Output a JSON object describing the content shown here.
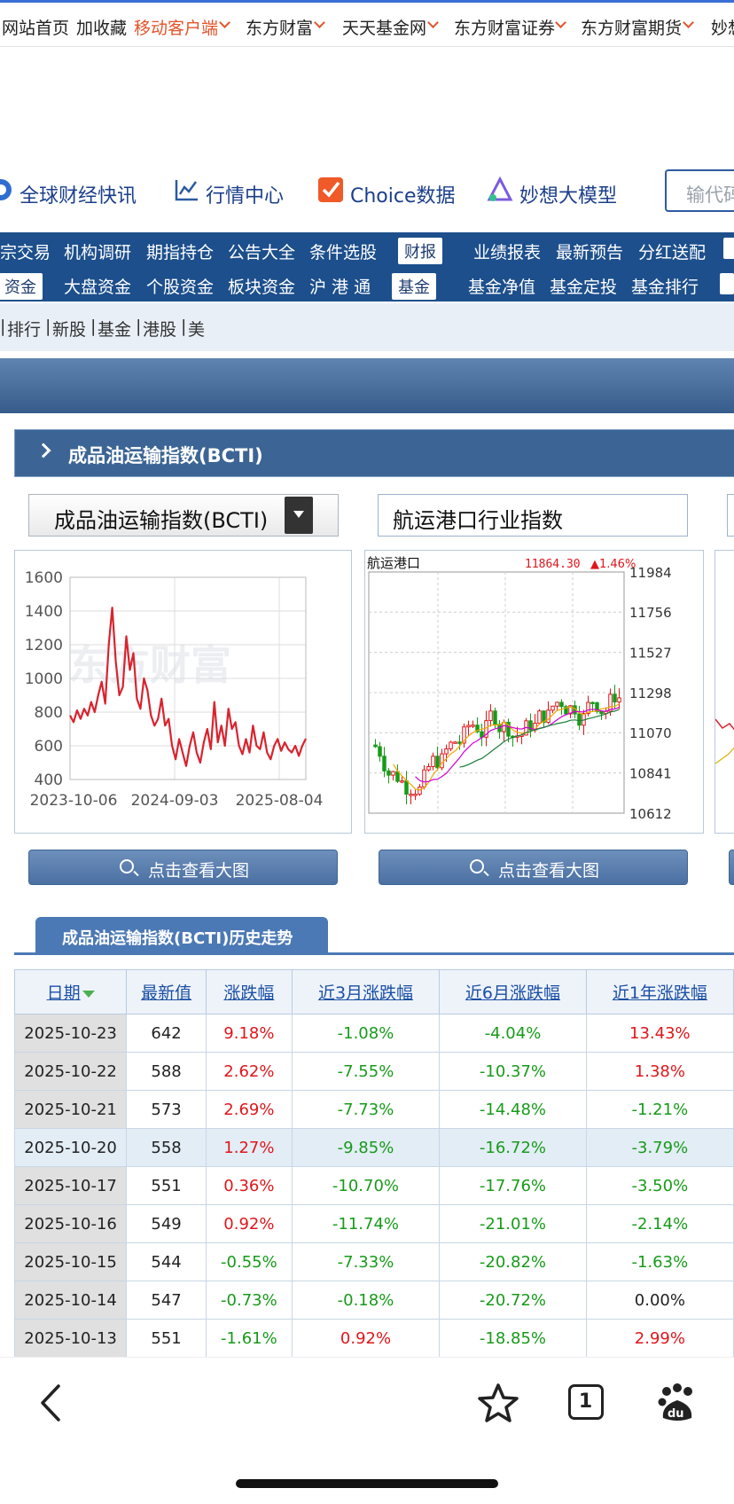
{
  "top_nav": {
    "items": [
      "网站首页",
      "加收藏",
      "移动客户端",
      "东方财富",
      "天天基金网",
      "东方财富证券",
      "东方财富期货",
      "妙想"
    ]
  },
  "secondary_nav": {
    "items": [
      "全球财经快讯",
      "行情中心",
      "Choice数据",
      "妙想大模型"
    ],
    "search_placeholder": "输代码"
  },
  "blue_menu": {
    "row1": [
      "宗交易",
      "机构调研",
      "期指持仓",
      "公告大全",
      "条件选股",
      "财报",
      "业绩报表",
      "最新预告",
      "分红送配"
    ],
    "row2": [
      "资金",
      "大盘资金",
      "个股资金",
      "板块资金",
      "沪 港 通",
      "基金",
      "基金净值",
      "基金定投",
      "基金排行"
    ]
  },
  "sub_links": [
    "排行",
    "新股",
    "基金",
    "港股",
    "美"
  ],
  "section": {
    "title": "成品油运输指数(BCTI)",
    "select_value": "成品油运输指数(BCTI)",
    "select2_value": "航运港口行业指数",
    "view_big_label": "点击查看大图",
    "history_tab": "成品油运输指数(BCTI)历史走势"
  },
  "chart_data": [
    {
      "type": "line",
      "x_ticks": [
        "2023-10-06",
        "2024-09-03",
        "2025-08-04"
      ],
      "y_ticks": [
        400,
        600,
        800,
        1000,
        1200,
        1400,
        1600
      ],
      "ylim": [
        400,
        1600
      ],
      "series": [
        {
          "color": "#d9232e",
          "values": [
            780,
            740,
            810,
            760,
            820,
            780,
            860,
            800,
            900,
            980,
            850,
            1200,
            1420,
            1100,
            900,
            950,
            1250,
            1050,
            1150,
            880,
            820,
            1000,
            930,
            780,
            720,
            760,
            880,
            720,
            760,
            600,
            520,
            640,
            560,
            480,
            600,
            680,
            560,
            500,
            620,
            700,
            580,
            860,
            620,
            720,
            600,
            820,
            700,
            740,
            600,
            550,
            640,
            560,
            720,
            600,
            580,
            680,
            560,
            520,
            600,
            640,
            570,
            620,
            580,
            560,
            600,
            540,
            600,
            642
          ]
        }
      ]
    },
    {
      "type": "candlestick",
      "title": "航运港口",
      "last_value": "11864.30",
      "change": "▲1.46%",
      "y_ticks": [
        10612,
        10841,
        11070,
        11298,
        11527,
        11756,
        11984
      ],
      "ylim": [
        10612,
        11984
      ]
    }
  ],
  "table": {
    "headers": [
      "日期",
      "最新值",
      "涨跌幅",
      "近3月涨跌幅",
      "近6月涨跌幅",
      "近1年涨跌幅"
    ],
    "rows": [
      [
        "2025-10-23",
        "642",
        "9.18%",
        "-1.08%",
        "-4.04%",
        "13.43%"
      ],
      [
        "2025-10-22",
        "588",
        "2.62%",
        "-7.55%",
        "-10.37%",
        "1.38%"
      ],
      [
        "2025-10-21",
        "573",
        "2.69%",
        "-7.73%",
        "-14.48%",
        "-1.21%"
      ],
      [
        "2025-10-20",
        "558",
        "1.27%",
        "-9.85%",
        "-16.72%",
        "-3.79%"
      ],
      [
        "2025-10-17",
        "551",
        "0.36%",
        "-10.70%",
        "-17.76%",
        "-3.50%"
      ],
      [
        "2025-10-16",
        "549",
        "0.92%",
        "-11.74%",
        "-21.01%",
        "-2.14%"
      ],
      [
        "2025-10-15",
        "544",
        "-0.55%",
        "-7.33%",
        "-20.82%",
        "-1.63%"
      ],
      [
        "2025-10-14",
        "547",
        "-0.73%",
        "-0.18%",
        "-20.72%",
        "0.00%"
      ],
      [
        "2025-10-13",
        "551",
        "-1.61%",
        "0.92%",
        "-18.85%",
        "2.99%"
      ]
    ]
  },
  "bottom_bar": {
    "tab_count": "1",
    "icons": [
      "back-icon",
      "star-icon",
      "tabs-icon",
      "baidu-paw-icon"
    ]
  },
  "colors": {
    "up": "#e0161b",
    "down": "#179b19",
    "accent": "#1d4f8c"
  }
}
